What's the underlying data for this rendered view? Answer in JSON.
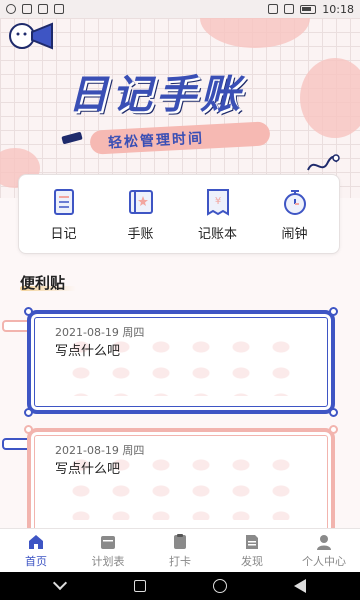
{
  "status_bar": {
    "time": "10:18"
  },
  "header": {
    "title": "日记手账",
    "subtitle": "轻松管理时间"
  },
  "quick_actions": [
    {
      "label": "日记",
      "icon": "diary-icon"
    },
    {
      "label": "手账",
      "icon": "handbook-icon"
    },
    {
      "label": "记账本",
      "icon": "ledger-icon"
    },
    {
      "label": "闹钟",
      "icon": "alarm-clock-icon"
    }
  ],
  "notes_section": {
    "title": "便利贴"
  },
  "notes": [
    {
      "date": "2021-08-19 周四",
      "text": "写点什么吧"
    },
    {
      "date": "2021-08-19 周四",
      "text": "写点什么吧"
    }
  ],
  "bottom_nav": [
    {
      "label": "首页",
      "icon": "home-icon",
      "active": true
    },
    {
      "label": "计划表",
      "icon": "calendar-icon",
      "active": false
    },
    {
      "label": "打卡",
      "icon": "checkin-icon",
      "active": false
    },
    {
      "label": "发现",
      "icon": "discover-icon",
      "active": false
    },
    {
      "label": "个人中心",
      "icon": "profile-icon",
      "active": false
    }
  ],
  "colors": {
    "accent": "#3e55c4",
    "pink": "#f2b4ae",
    "background": "#fdf7f7"
  }
}
